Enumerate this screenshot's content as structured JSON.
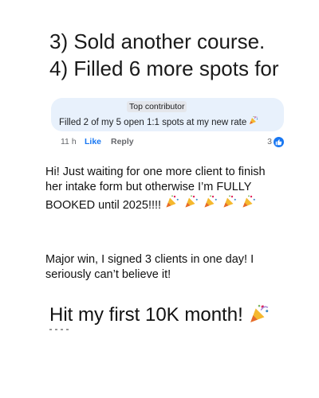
{
  "headline": {
    "line1": "3) Sold another course.",
    "line2": "4) Filled 6 more spots for"
  },
  "comment": {
    "badge": "Top contributor",
    "text": "Filled 2 of my 5 open 1:1 spots at my new rate",
    "emoji": "party-popper-icon",
    "time": "11 h",
    "like_label": "Like",
    "reply_label": "Reply",
    "reaction_count": "3",
    "colors": {
      "bubble": "#e8f1fc",
      "accent": "#1877f2"
    }
  },
  "testimonial1": {
    "text": "Hi! Just waiting for one more client to finish her intake form but otherwise I’m FULLY BOOKED until 2025!!!!"
  },
  "testimonial2": {
    "text": "Major win, I signed 3 clients in one day! I seriously can’t believe it!"
  },
  "testimonial3": {
    "text": "Hit my first 10K month!"
  }
}
